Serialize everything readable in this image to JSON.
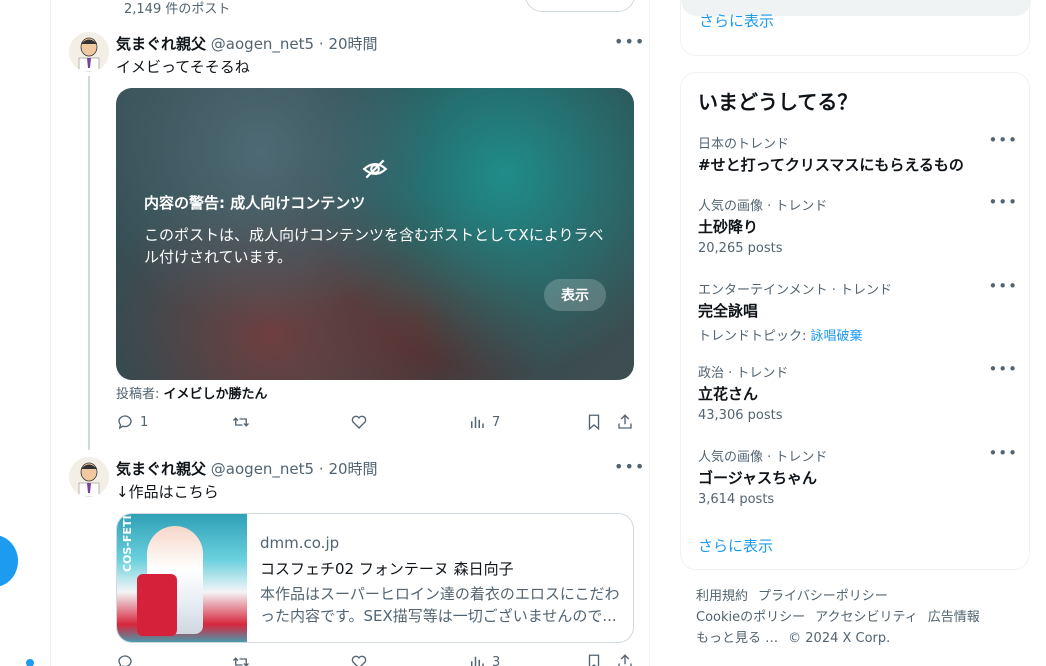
{
  "header": {
    "post_count": "2,149 件のポスト"
  },
  "tweets": [
    {
      "name": "気まぐれ親父",
      "handle": "@aogen_net5",
      "sep": "·",
      "time": "20時間",
      "text": "イメビってそそるね",
      "media_warning": {
        "title": "内容の警告: 成人向けコンテンツ",
        "desc": "このポストは、成人向けコンテンツを含むポストとしてXによりラベル付けされています。",
        "show_label": "表示"
      },
      "poster_label": "投稿者: ",
      "poster_name": "イメビしか勝たん",
      "actions": {
        "reply": "1",
        "retweet": "",
        "like": "",
        "views": "7"
      }
    },
    {
      "name": "気まぐれ親父",
      "handle": "@aogen_net5",
      "sep": "·",
      "time": "20時間",
      "text": "↓作品はこちら",
      "card": {
        "domain": "dmm.co.jp",
        "title": "コスフェチ02 フォンテーヌ 森日向子",
        "desc": "本作品はスーパーヒロイン達の着衣のエロスにこだわった内容です。SEX描写等は一切ございませんので...",
        "image_text": "COS-FETI"
      },
      "actions": {
        "reply": "",
        "retweet": "",
        "like": "",
        "views": "3"
      }
    }
  ],
  "sidebar": {
    "prev_show_more": "さらに表示",
    "trends_title": "いまどうしてる？",
    "trends": [
      {
        "meta": "日本のトレンド",
        "name": "#せと打ってクリスマスにもらえるもの",
        "count": ""
      },
      {
        "meta": "人気の画像 · トレンド",
        "name": "土砂降り",
        "count": "20,265 posts"
      },
      {
        "meta": "エンターテインメント · トレンド",
        "name": "完全詠唱",
        "count_prefix": "トレンドトピック: ",
        "count_link": "詠唱破棄"
      },
      {
        "meta": "政治 · トレンド",
        "name": "立花さん",
        "count": "43,306 posts"
      },
      {
        "meta": "人気の画像 · トレンド",
        "name": "ゴージャスちゃん",
        "count": "3,614 posts"
      }
    ],
    "trends_more": "さらに表示",
    "footer": [
      "利用規約",
      "プライバシーポリシー",
      "Cookieのポリシー",
      "アクセシビリティ",
      "広告情報",
      "もっと見る …",
      "© 2024 X Corp."
    ]
  },
  "colors": {
    "accent": "#1d9bf0",
    "muted": "#536471",
    "text": "#0f1419"
  }
}
